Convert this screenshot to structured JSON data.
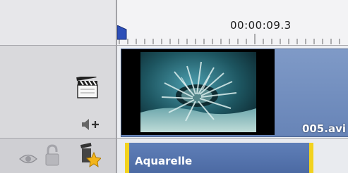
{
  "ruler": {
    "timecode": "00:00:09.3"
  },
  "video_track": {
    "clip_name": "005.avi"
  },
  "effect_track": {
    "clip_label": "Aquarelle"
  },
  "icons": {
    "track_type": "clapperboard-icon",
    "audio": "speaker-add-icon",
    "visibility": "eye-icon",
    "lock": "lock-icon",
    "effect": "effect-star-icon"
  },
  "colors": {
    "clip": "#6b88bb",
    "effect_border": "#f2d21e"
  }
}
